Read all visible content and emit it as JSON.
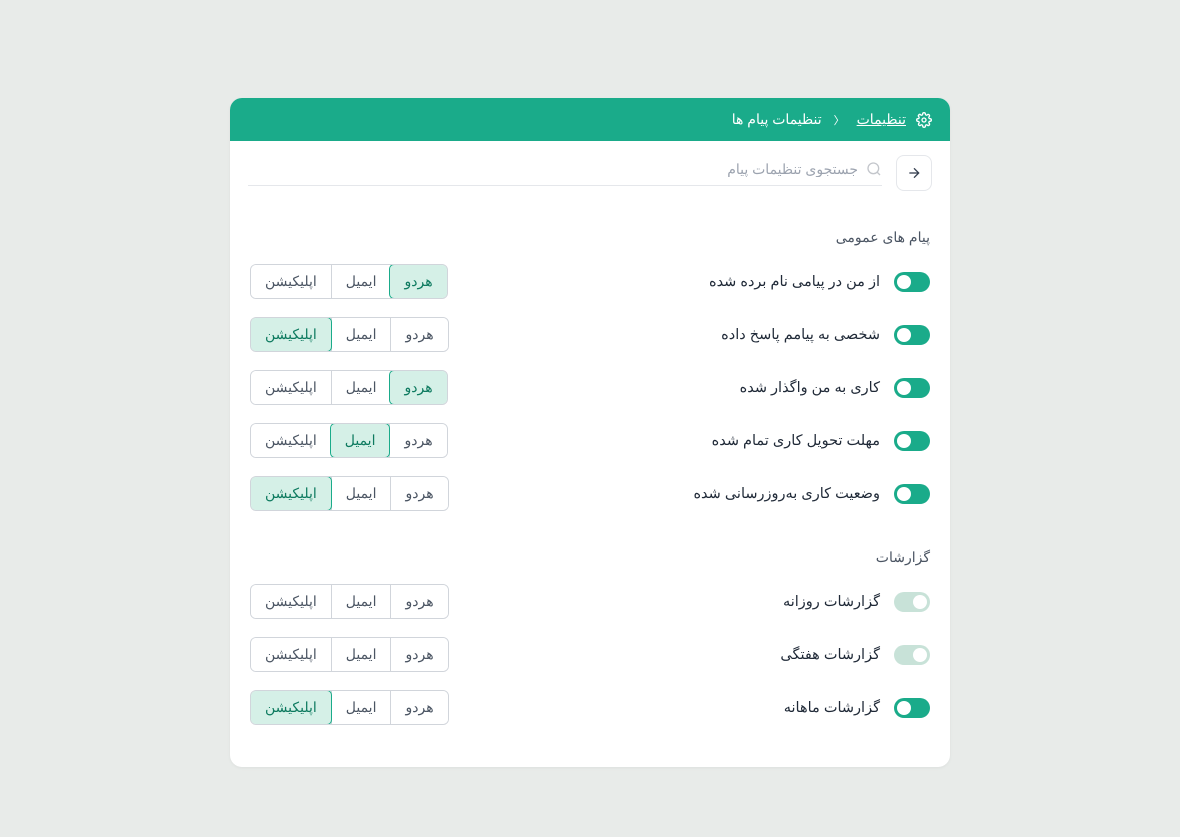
{
  "header": {
    "breadcrumb_root": "تنظیمات",
    "breadcrumb_current": "تنظیمات پیام ها"
  },
  "search": {
    "placeholder": "جستجوی تنظیمات پیام"
  },
  "segments": {
    "both": "هردو",
    "email": "ایمیل",
    "app": "اپلیکیشن"
  },
  "sections": [
    {
      "title": "پیام های عمومی",
      "rows": [
        {
          "label": "از من در پیامی نام برده شده",
          "enabled": true,
          "selected": "both"
        },
        {
          "label": "شخصی به پیامم پاسخ داده",
          "enabled": true,
          "selected": "app"
        },
        {
          "label": "کاری به من واگذار شده",
          "enabled": true,
          "selected": "both"
        },
        {
          "label": "مهلت تحویل کاری تمام شده",
          "enabled": true,
          "selected": "email"
        },
        {
          "label": "وضعیت کاری به‌روزرسانی شده",
          "enabled": true,
          "selected": "app"
        }
      ]
    },
    {
      "title": "گزارشات",
      "rows": [
        {
          "label": "گزارشات روزانه",
          "enabled": false,
          "selected": "none"
        },
        {
          "label": "گزارشات هفتگی",
          "enabled": false,
          "selected": "none"
        },
        {
          "label": "گزارشات ماهانه",
          "enabled": true,
          "selected": "app"
        }
      ]
    }
  ]
}
